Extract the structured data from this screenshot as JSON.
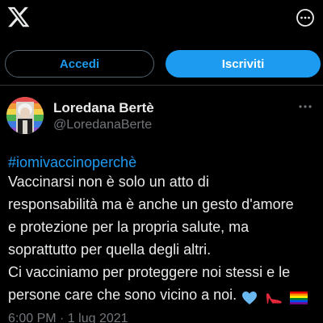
{
  "header": {
    "logo_icon": "x-logo-icon",
    "more_icon": "more-options-icon"
  },
  "auth": {
    "login_label": "Accedi",
    "signup_label": "Iscriviti"
  },
  "post": {
    "author": {
      "display_name": "Loredana Bertè",
      "handle": "@LoredanaBerte",
      "avatar_icon": "avatar-image"
    },
    "hashtag": "#iomivaccinoperchè",
    "text_lines": [
      "Vaccinarsi non è solo un atto di",
      "responsabilità ma è anche un gesto d'amore",
      "e protezione per la propria salute, ma",
      "soprattutto per quella degli altri.",
      "Ci vacciniamo per proteggere noi stessi e le",
      "persone care che sono vicino a noi."
    ],
    "emojis": [
      "light-blue-heart",
      "high-heel-shoe",
      "rainbow-flag"
    ],
    "timestamp": "6:00 PM · 1 lug 2021"
  },
  "colors": {
    "background": "#000000",
    "text": "#e7e9ea",
    "muted": "#71767b",
    "accent": "#1d9bf0",
    "border": "#536471"
  }
}
